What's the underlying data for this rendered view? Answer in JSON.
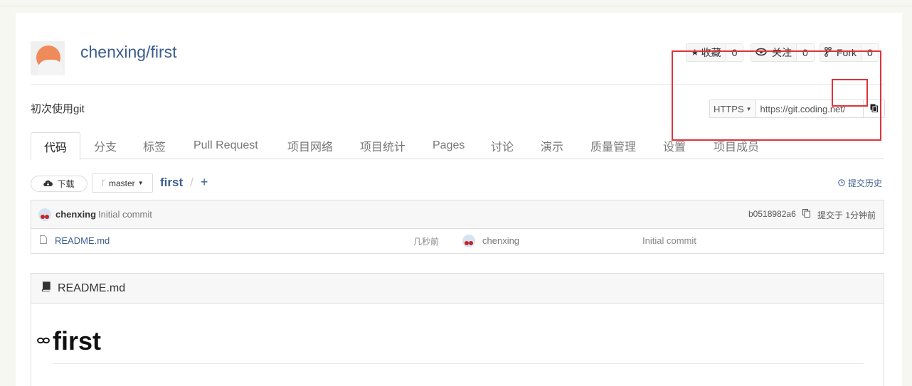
{
  "repo": {
    "title": "chenxing/first",
    "description": "初次使用git"
  },
  "social": {
    "star_label": "收藏",
    "star_count": "0",
    "watch_label": "关注",
    "watch_count": "0",
    "fork_label": "Fork",
    "fork_count": "0"
  },
  "clone": {
    "protocol": "HTTPS",
    "url": "https://git.coding.net/"
  },
  "tabs": [
    "代码",
    "分支",
    "标签",
    "Pull Request",
    "项目网络",
    "项目统计",
    "Pages",
    "讨论",
    "演示",
    "质量管理",
    "设置",
    "项目成员"
  ],
  "toolbar": {
    "download_label": "下载",
    "branch": "master",
    "breadcrumb": "first",
    "slash": "/",
    "add": "+",
    "history_label": "提交历史"
  },
  "latest_commit": {
    "author": "chenxing",
    "message": "Initial commit",
    "hash": "b0518982a6",
    "time": "提交于 1分钟前"
  },
  "files": [
    {
      "name": "README.md",
      "age": "几秒前",
      "author": "chenxing",
      "message": "Initial commit"
    }
  ],
  "readme": {
    "filename": "README.md",
    "heading": "first"
  },
  "colors": {
    "link": "#3b5d8c",
    "highlight": "#e0323a"
  }
}
